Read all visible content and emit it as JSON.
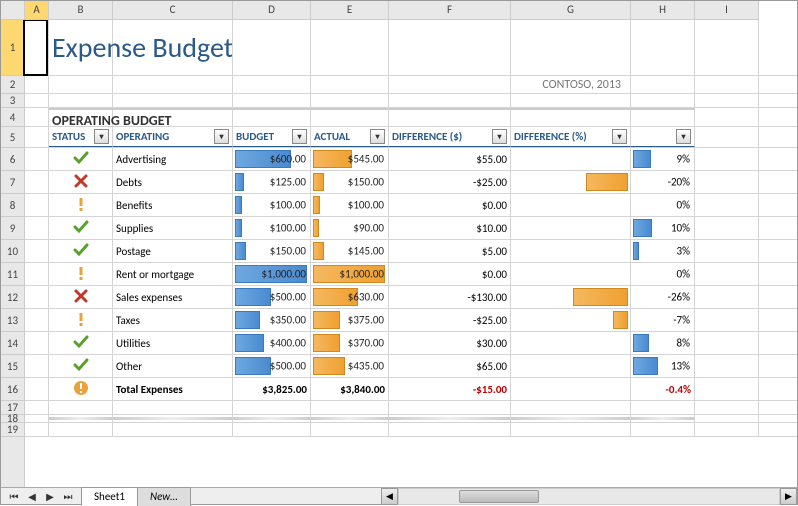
{
  "title": "Expense Budget",
  "subtitle": "CONTOSO, 2013",
  "section": "OPERATING BUDGET",
  "columns": {
    "status": "STATUS",
    "operating": "OPERATING",
    "budget": "BUDGET",
    "actual": "ACTUAL",
    "diff_dollar": "DIFFERENCE ($)",
    "diff_pct": "DIFFERENCE (%)"
  },
  "col_letters": [
    "A",
    "B",
    "C",
    "D",
    "E",
    "F",
    "G",
    "H",
    "I"
  ],
  "row_numbers": [
    "1",
    "2",
    "3",
    "4",
    "5",
    "6",
    "7",
    "8",
    "9",
    "10",
    "11",
    "12",
    "13",
    "14",
    "15",
    "16",
    "17",
    "18",
    "19"
  ],
  "rows": [
    {
      "status": "check",
      "name": "Advertising",
      "budget": "$600.00",
      "budget_pct": 78,
      "actual": "$545.00",
      "actual_pct": 54,
      "diff": "$55.00",
      "pct": "9%",
      "pct_bar": 35
    },
    {
      "status": "cross",
      "name": "Debts",
      "budget": "$125.00",
      "budget_pct": 13,
      "actual": "$150.00",
      "actual_pct": 15,
      "diff": "-$25.00",
      "pct": "-20%",
      "pct_bar": -77
    },
    {
      "status": "warn",
      "name": "Benefits",
      "budget": "$100.00",
      "budget_pct": 10,
      "actual": "$100.00",
      "actual_pct": 10,
      "diff": "$0.00",
      "pct": "0%",
      "pct_bar": 0
    },
    {
      "status": "check",
      "name": "Supplies",
      "budget": "$100.00",
      "budget_pct": 10,
      "actual": "$90.00",
      "actual_pct": 9,
      "diff": "$10.00",
      "pct": "10%",
      "pct_bar": 38
    },
    {
      "status": "check",
      "name": "Postage",
      "budget": "$150.00",
      "budget_pct": 15,
      "actual": "$145.00",
      "actual_pct": 15,
      "diff": "$5.00",
      "pct": "3%",
      "pct_bar": 12
    },
    {
      "status": "warn",
      "name": "Rent or mortgage",
      "budget": "$1,000.00",
      "budget_pct": 100,
      "actual": "$1,000.00",
      "actual_pct": 100,
      "diff": "$0.00",
      "pct": "0%",
      "pct_bar": 0
    },
    {
      "status": "cross",
      "name": "Sales expenses",
      "budget": "$500.00",
      "budget_pct": 50,
      "actual": "$630.00",
      "actual_pct": 63,
      "diff": "-$130.00",
      "pct": "-26%",
      "pct_bar": -100
    },
    {
      "status": "warn",
      "name": "Taxes",
      "budget": "$350.00",
      "budget_pct": 35,
      "actual": "$375.00",
      "actual_pct": 38,
      "diff": "-$25.00",
      "pct": "-7%",
      "pct_bar": -27
    },
    {
      "status": "check",
      "name": "Utilities",
      "budget": "$400.00",
      "budget_pct": 40,
      "actual": "$370.00",
      "actual_pct": 37,
      "diff": "$30.00",
      "pct": "8%",
      "pct_bar": 31
    },
    {
      "status": "check",
      "name": "Other",
      "budget": "$500.00",
      "budget_pct": 50,
      "actual": "$435.00",
      "actual_pct": 44,
      "diff": "$65.00",
      "pct": "13%",
      "pct_bar": 50
    }
  ],
  "total": {
    "status": "total",
    "name": "Total Expenses",
    "budget": "$3,825.00",
    "actual": "$3,840.00",
    "diff": "-$15.00",
    "pct": "-0.4%"
  },
  "tabs": {
    "sheet1": "Sheet1",
    "new": "New…"
  },
  "col_widths": {
    "A": 24,
    "B": 64,
    "C": 120,
    "D": 78,
    "E": 78,
    "F": 122,
    "G": 120,
    "H": 64,
    "I": 64
  },
  "chart_data": {
    "type": "table",
    "title": "Operating Budget",
    "columns": [
      "Operating",
      "Budget",
      "Actual",
      "Difference ($)",
      "Difference (%)"
    ],
    "rows": [
      [
        "Advertising",
        600.0,
        545.0,
        55.0,
        0.09
      ],
      [
        "Debts",
        125.0,
        150.0,
        -25.0,
        -0.2
      ],
      [
        "Benefits",
        100.0,
        100.0,
        0.0,
        0.0
      ],
      [
        "Supplies",
        100.0,
        90.0,
        10.0,
        0.1
      ],
      [
        "Postage",
        150.0,
        145.0,
        5.0,
        0.03
      ],
      [
        "Rent or mortgage",
        1000.0,
        1000.0,
        0.0,
        0.0
      ],
      [
        "Sales expenses",
        500.0,
        630.0,
        -130.0,
        -0.26
      ],
      [
        "Taxes",
        350.0,
        375.0,
        -25.0,
        -0.07
      ],
      [
        "Utilities",
        400.0,
        370.0,
        30.0,
        0.08
      ],
      [
        "Other",
        500.0,
        435.0,
        65.0,
        0.13
      ]
    ],
    "totals": [
      "Total Expenses",
      3825.0,
      3840.0,
      -15.0,
      -0.004
    ]
  }
}
